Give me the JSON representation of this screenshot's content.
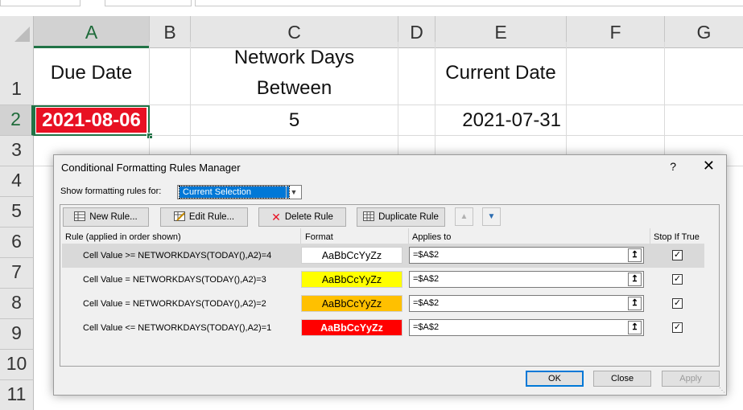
{
  "columns": [
    "A",
    "B",
    "C",
    "D",
    "E",
    "F",
    "G"
  ],
  "rows": [
    "1",
    "2",
    "3",
    "4",
    "5",
    "6",
    "7",
    "8",
    "9",
    "10",
    "11"
  ],
  "cells": {
    "A1": "Due Date",
    "C1": "Network Days Between",
    "E1": "Current Date",
    "A2": "2021-08-06",
    "C2": "5",
    "E2": "2021-07-31"
  },
  "colors": {
    "header_bg": "#e6e6e6",
    "selection_green": "#217346",
    "alert_red": "#e81123",
    "yellow": "#ffff00",
    "orange": "#ffc000",
    "red": "#ff0000",
    "highlight_blue": "#0078d7"
  },
  "dialog": {
    "title": "Conditional Formatting Rules Manager",
    "help": "?",
    "close": "✕",
    "show_label": "Show formatting rules for:",
    "show_value": "Current Selection",
    "toolbar": {
      "new_rule": "New Rule...",
      "edit_rule": "Edit Rule...",
      "delete_rule": "Delete Rule",
      "duplicate_rule": "Duplicate Rule"
    },
    "headers": {
      "rule": "Rule (applied in order shown)",
      "format": "Format",
      "applies": "Applies to",
      "stop": "Stop If True"
    },
    "rules": [
      {
        "rule": "Cell Value >= NETWORKDAYS(TODAY(),A2)=4",
        "preview": "AaBbCcYyZz",
        "applies": "=$A$2",
        "stop": true,
        "fill": "#ffffff",
        "text_color": "#000000"
      },
      {
        "rule": "Cell Value = NETWORKDAYS(TODAY(),A2)=3",
        "preview": "AaBbCcYyZz",
        "applies": "=$A$2",
        "stop": true,
        "fill": "#ffff00",
        "text_color": "#000000"
      },
      {
        "rule": "Cell Value = NETWORKDAYS(TODAY(),A2)=2",
        "preview": "AaBbCcYyZz",
        "applies": "=$A$2",
        "stop": true,
        "fill": "#ffc000",
        "text_color": "#000000"
      },
      {
        "rule": "Cell Value <= NETWORKDAYS(TODAY(),A2)=1",
        "preview": "AaBbCcYyZz",
        "applies": "=$A$2",
        "stop": true,
        "fill": "#ff0000",
        "text_color": "#ffffff"
      }
    ],
    "buttons": {
      "ok": "OK",
      "close": "Close",
      "apply": "Apply"
    }
  }
}
